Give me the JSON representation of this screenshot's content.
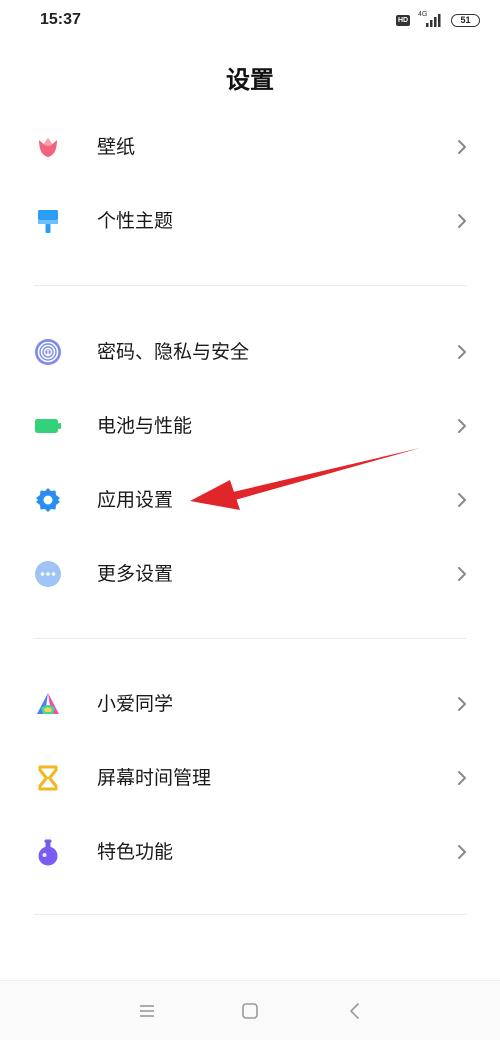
{
  "status_bar": {
    "time": "15:37",
    "hd": "HD",
    "network": "4G",
    "battery": "51"
  },
  "title": "设置",
  "groups": [
    [
      {
        "label": "壁纸",
        "icon": "tulip-icon"
      },
      {
        "label": "个性主题",
        "icon": "paint-brush-icon"
      }
    ],
    [
      {
        "label": "密码、隐私与安全",
        "icon": "fingerprint-icon"
      },
      {
        "label": "电池与性能",
        "icon": "battery-icon"
      },
      {
        "label": "应用设置",
        "icon": "gear-icon"
      },
      {
        "label": "更多设置",
        "icon": "more-dots-icon"
      }
    ],
    [
      {
        "label": "小爱同学",
        "icon": "xiaoai-icon"
      },
      {
        "label": "屏幕时间管理",
        "icon": "hourglass-icon"
      },
      {
        "label": "特色功能",
        "icon": "flask-icon"
      }
    ]
  ],
  "nav_bar": {
    "buttons": [
      "menu-icon",
      "home-icon",
      "back-icon"
    ]
  },
  "annotation": {
    "arrow_color": "#e0262b",
    "points_to": "应用设置"
  }
}
